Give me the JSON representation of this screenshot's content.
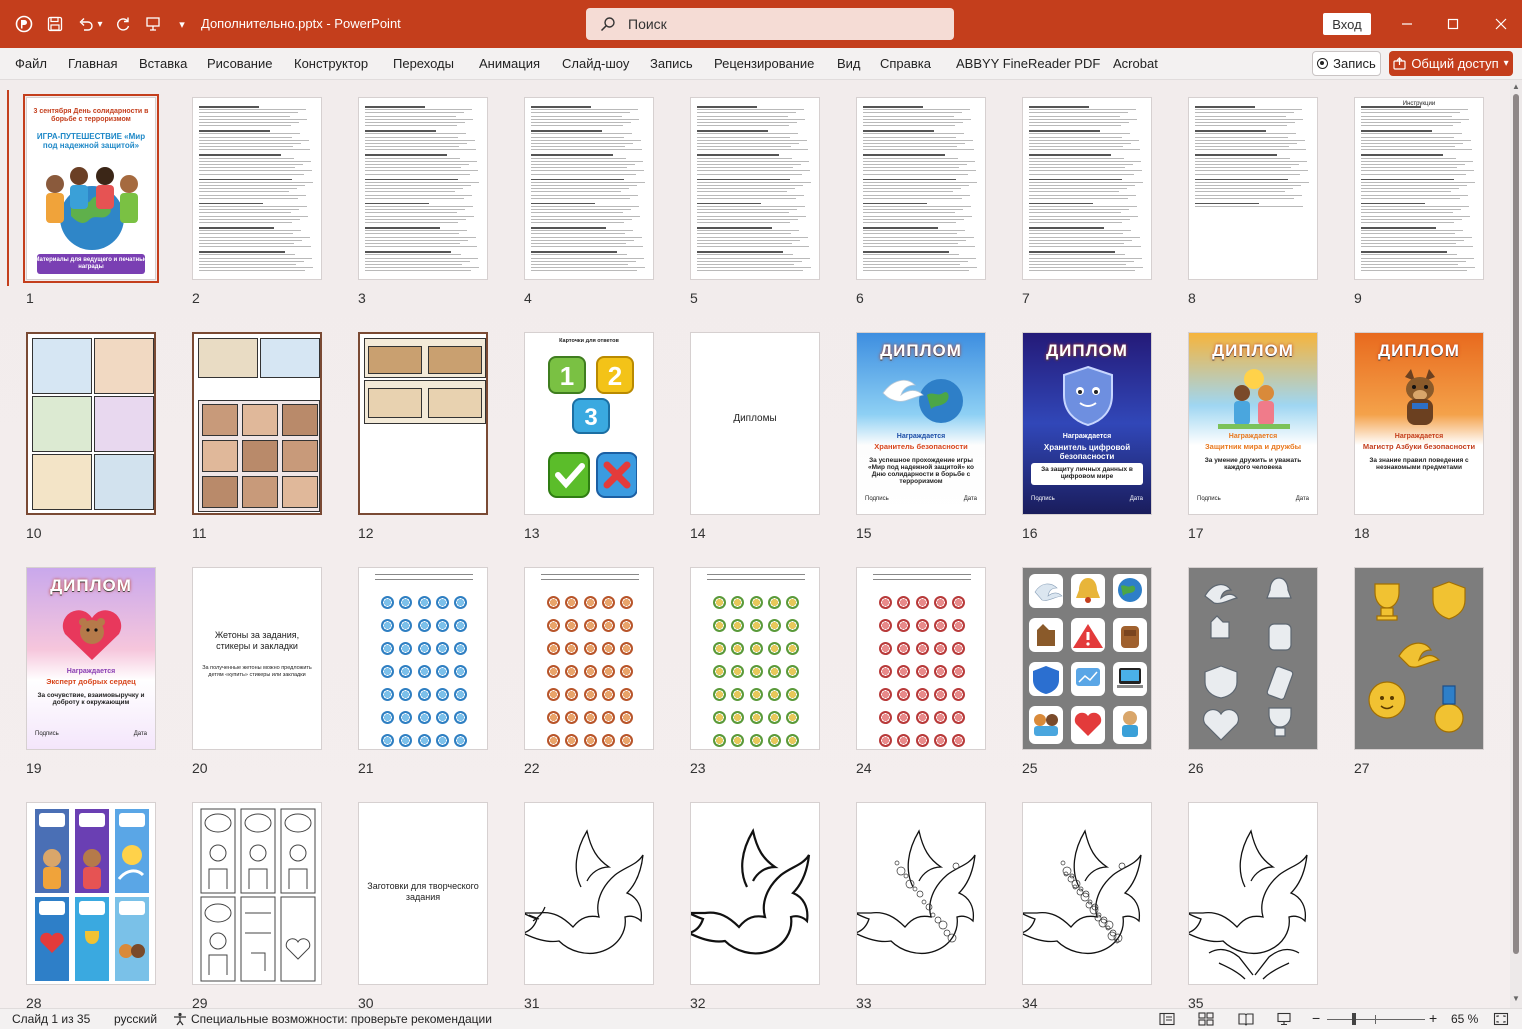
{
  "titlebar": {
    "doc_title": "Дополнительно.pptx  -  PowerPoint",
    "search_placeholder": "Поиск",
    "signin_label": "Вход"
  },
  "menu": {
    "items": [
      "Файл",
      "Главная",
      "Вставка",
      "Рисование",
      "Конструктор",
      "Переходы",
      "Анимация",
      "Слайд-шоу",
      "Запись",
      "Рецензирование",
      "Вид",
      "Справка",
      "ABBYY FineReader PDF",
      "Acrobat"
    ],
    "record_label": "Запись",
    "share_label": "Общий доступ"
  },
  "slides": {
    "numbers": [
      "1",
      "2",
      "3",
      "4",
      "5",
      "6",
      "7",
      "8",
      "9",
      "10",
      "11",
      "12",
      "13",
      "14",
      "15",
      "16",
      "17",
      "18",
      "19",
      "20",
      "21",
      "22",
      "23",
      "24",
      "25",
      "26",
      "27",
      "28",
      "29",
      "30",
      "31",
      "32",
      "33",
      "34",
      "35"
    ],
    "s1_title": "3 сентября День солидарности в борьбе с терроризмом",
    "s1_game": "ИГРА-ПУТЕШЕСТВИЕ «Мир под надежной защитой»",
    "s1_footer": "Материалы для ведущего и печатные награды",
    "s9_title": "Инструкции",
    "s13_title": "Карточки для ответов",
    "s14_text": "Дипломы",
    "diploma_word": "ДИПЛОМ",
    "awarded": "Награждается",
    "s15_name": "Хранитель безопасности",
    "s15_desc": "За успешное прохождение игры «Мир под надежной защитой» ко Дню солидарности в борьбе с терроризмом",
    "s16_name": "Хранитель цифровой безопасности",
    "s16_desc": "За защиту личных данных в цифровом мире",
    "s17_name": "Защитник мира и дружбы",
    "s17_desc": "За умение дружить и уважать каждого человека",
    "s18_name": "Магистр Азбуки безопасности",
    "s18_desc": "За знание правил поведения с незнакомыми предметами",
    "s19_name": "Эксперт добрых сердец",
    "s19_desc": "За сочувствие, взаимовыручку и доброту к окружающим",
    "sign_label": "Подпись",
    "date_label": "Дата",
    "s20_title": "Жетоны за задания, стикеры и закладки",
    "s20_sub": "За полученные жетоны можно предложить детям «купить» стикеры или закладки",
    "s30_text": "Заготовки для творческого задания"
  },
  "status": {
    "slide_counter": "Слайд 1 из 35",
    "language": "русский",
    "accessibility": "Специальные возможности: проверьте рекомендации",
    "zoom_level": "65 %"
  },
  "colors": {
    "brand": "#c43e1c",
    "diploma_blue": "#1e4fa8",
    "diploma_orange": "#e8781e",
    "sticker_gray": "#7d7d7d"
  }
}
